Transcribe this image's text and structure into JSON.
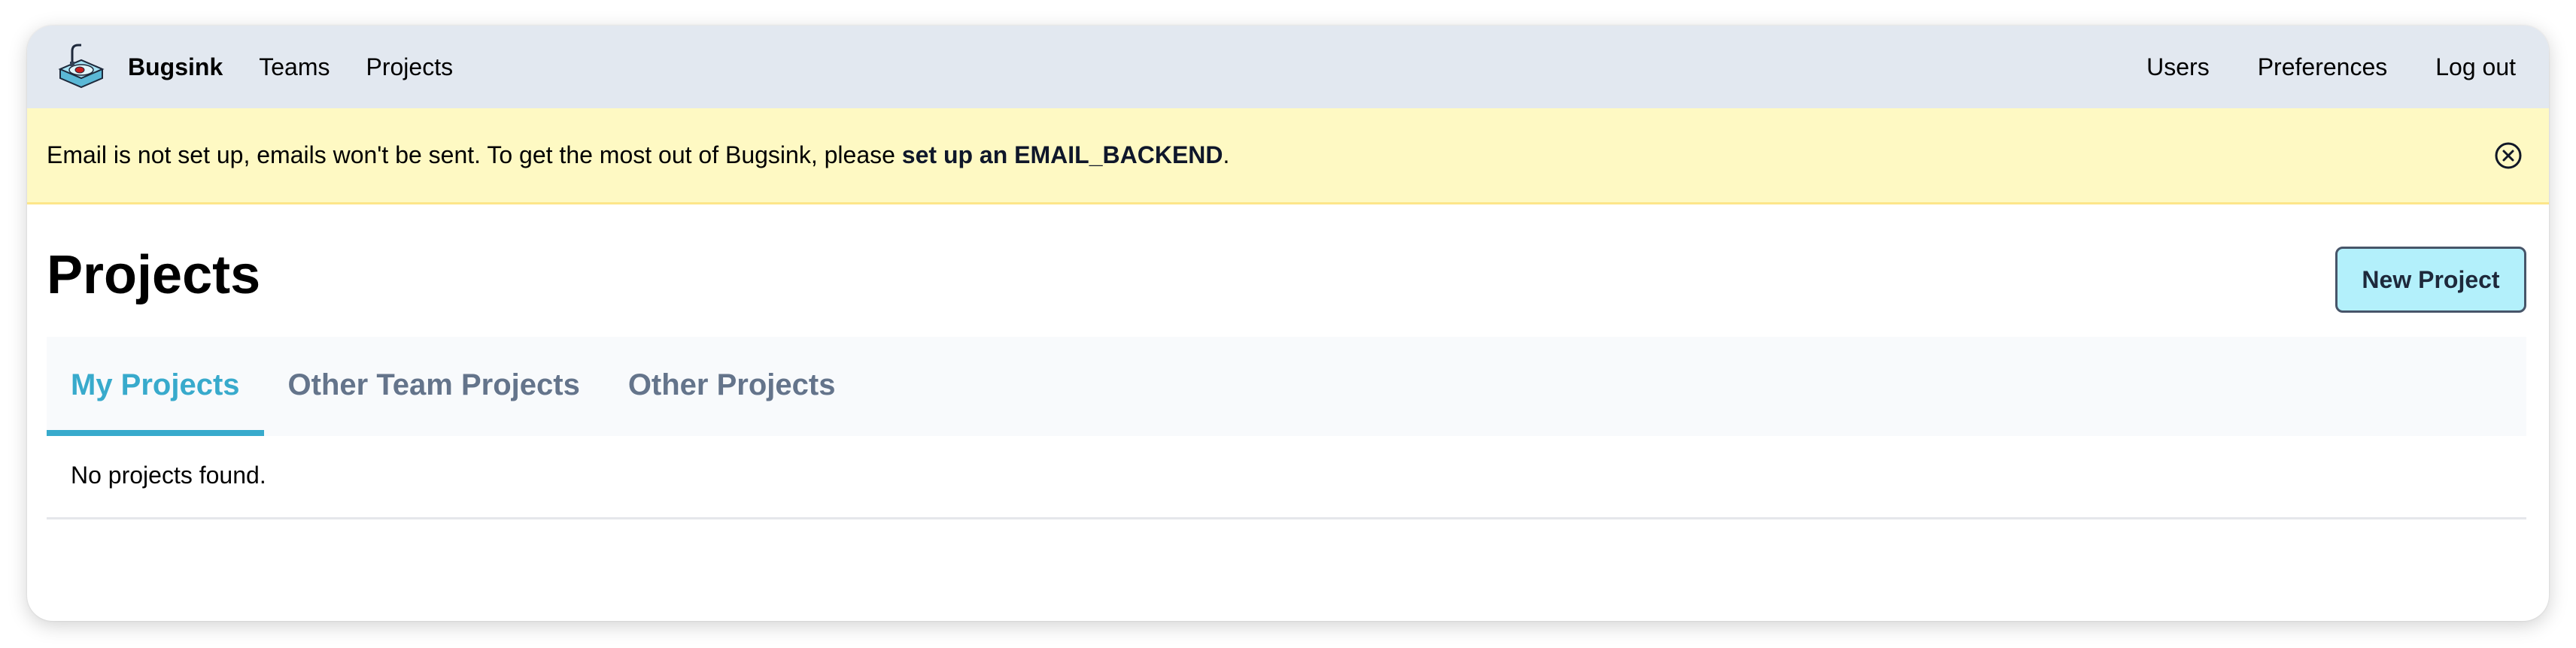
{
  "navbar": {
    "brand": "Bugsink",
    "left_links": [
      "Teams",
      "Projects"
    ],
    "right_links": [
      "Users",
      "Preferences",
      "Log out"
    ]
  },
  "banner": {
    "text_before": "Email is not set up, emails won't be sent. To get the most out of Bugsink, please ",
    "link_text": "set up an EMAIL_BACKEND",
    "text_after": ".",
    "close_icon": "close-circle-icon"
  },
  "page": {
    "title": "Projects",
    "new_button": "New Project"
  },
  "tabs": [
    {
      "label": "My Projects",
      "active": true
    },
    {
      "label": "Other Team Projects",
      "active": false
    },
    {
      "label": "Other Projects",
      "active": false
    }
  ],
  "empty_message": "No projects found.",
  "colors": {
    "navbar_bg": "#e2e8f0",
    "banner_bg": "#fef9c3",
    "accent": "#38aacc",
    "button_bg": "#b3f0fb",
    "tab_inactive": "#64748b"
  }
}
